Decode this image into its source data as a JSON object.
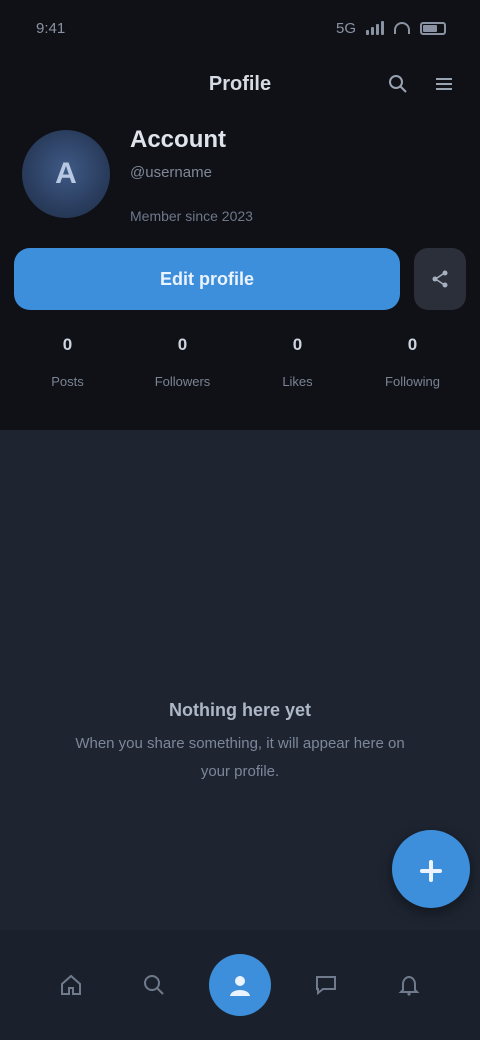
{
  "status_bar": {
    "time": "9:41",
    "network": "5G"
  },
  "header": {
    "title": "Profile"
  },
  "profile": {
    "initial": "A",
    "name": "Account",
    "handle": "@username",
    "meta": "Member since 2023"
  },
  "actions": {
    "primary_label": "Edit profile"
  },
  "stats": [
    {
      "value": "0",
      "label": "Posts"
    },
    {
      "value": "0",
      "label": "Followers"
    },
    {
      "value": "0",
      "label": "Likes"
    },
    {
      "value": "0",
      "label": "Following"
    }
  ],
  "empty_state": {
    "title": "Nothing here yet",
    "text": "When you share something, it will appear here on your profile."
  },
  "colors": {
    "accent": "#3d8fdb",
    "background": "#0f1116",
    "surface": "#1e2531"
  },
  "icons": {
    "search": "search-icon",
    "menu": "menu-icon",
    "share": "share-icon",
    "add": "plus-icon"
  }
}
